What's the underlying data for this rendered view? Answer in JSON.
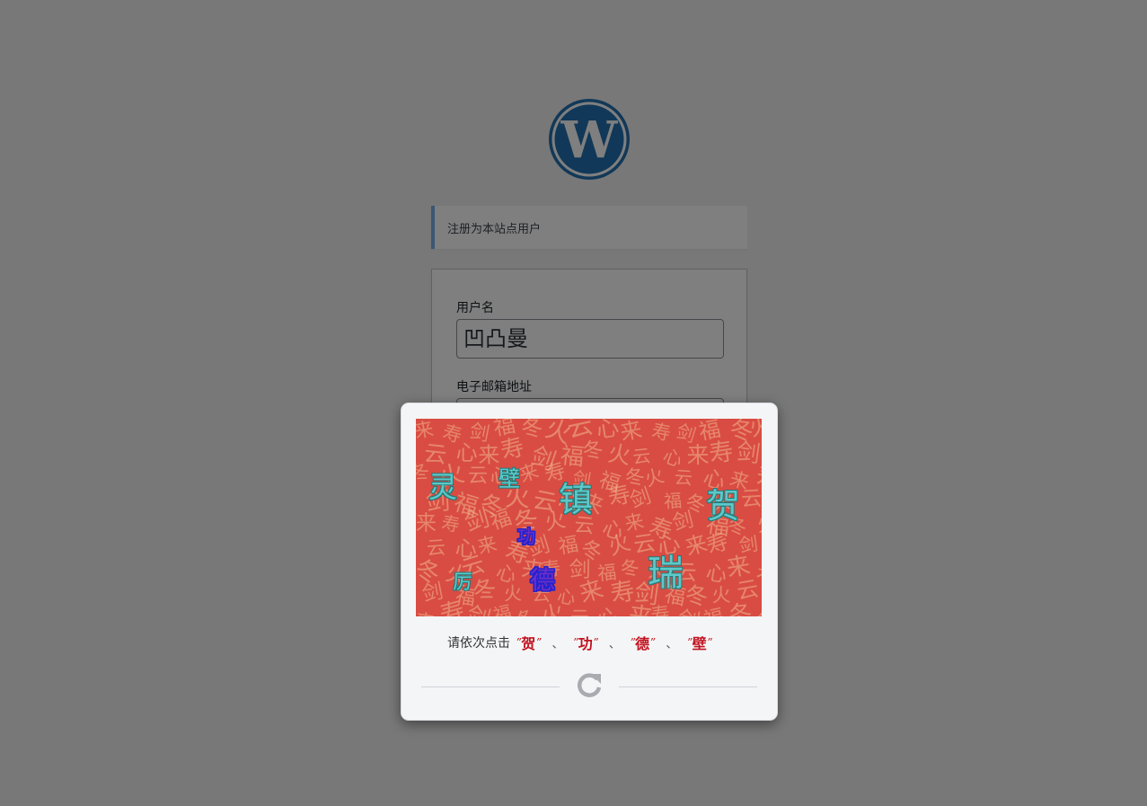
{
  "notice": {
    "text": "注册为本站点用户"
  },
  "form": {
    "username_label": "用户名",
    "username_value": "凹凸曼",
    "email_label": "电子邮箱地址"
  },
  "captcha": {
    "prompt": "请依次点击",
    "targets": [
      "贺",
      "功",
      "德",
      "壁"
    ],
    "separator": "、",
    "quote_open": "”",
    "quote_close": "”",
    "image_chars": [
      "灵",
      "壁",
      "镇",
      "贺",
      "功",
      "德",
      "瑞",
      "厉"
    ],
    "background_glyphs": [
      "来",
      "寿",
      "剑",
      "福",
      "冬",
      "火",
      "云",
      "心"
    ]
  },
  "colors": {
    "overlay": "#000000",
    "accent_blue": "#72aee6",
    "wp_blue": "#2271b1",
    "target_red": "#c1121f",
    "captcha_bg": "#d94c43",
    "char_teal": "#5ec8c8",
    "char_purple": "#6a2dc8"
  },
  "icons": {
    "logo": "wordpress-logo",
    "refresh": "refresh-icon"
  }
}
